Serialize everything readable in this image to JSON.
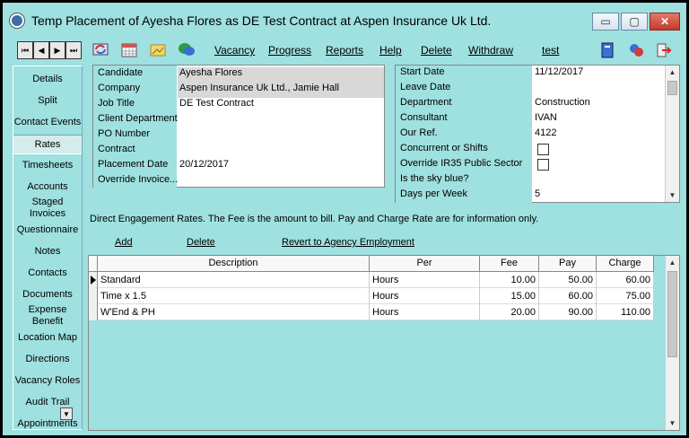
{
  "window": {
    "title": "Temp Placement of Ayesha Flores as DE Test Contract at Aspen Insurance Uk Ltd.",
    "minimize": "▭",
    "maximize": "▢",
    "close": "✕"
  },
  "toolbar": {
    "menus": [
      "Vacancy",
      "Progress",
      "Reports",
      "Help",
      "Delete",
      "Withdraw",
      "test"
    ]
  },
  "sidebar": {
    "items": [
      "Details",
      "Split",
      "Contact Events",
      "Rates",
      "Timesheets",
      "Accounts",
      "Staged Invoices",
      "Questionnaire",
      "Notes",
      "Contacts",
      "Documents",
      "Expense Benefit",
      "Location Map",
      "Directions",
      "Vacancy Roles",
      "Audit Trail",
      "Appointments"
    ],
    "active": "Rates"
  },
  "details_left": [
    {
      "label": "Candidate",
      "value": "Ayesha Flores"
    },
    {
      "label": "Company",
      "value": "Aspen Insurance Uk Ltd., Jamie Hall"
    },
    {
      "label": "Job Title",
      "value": "DE Test Contract"
    },
    {
      "label": "Client Department",
      "value": ""
    },
    {
      "label": "PO Number",
      "value": ""
    },
    {
      "label": "Contract",
      "value": ""
    },
    {
      "label": "Placement Date",
      "value": "20/12/2017"
    },
    {
      "label": "Override Invoice...",
      "value": ""
    }
  ],
  "details_right": [
    {
      "label": "Start Date",
      "value": "11/12/2017"
    },
    {
      "label": "Leave Date",
      "value": ""
    },
    {
      "label": "Department",
      "value": "Construction"
    },
    {
      "label": "Consultant",
      "value": "IVAN"
    },
    {
      "label": "Our Ref.",
      "value": "4122"
    },
    {
      "label": "Concurrent or Shifts",
      "value": ""
    },
    {
      "label": "Override IR35 Public Sector",
      "value": ""
    },
    {
      "label": "Is the sky blue?",
      "value": ""
    },
    {
      "label": "Days per Week",
      "value": "5"
    }
  ],
  "rates": {
    "note": "Direct Engagement Rates.  The Fee is the amount to bill.  Pay and Charge Rate are for information only.",
    "add": "Add",
    "delete": "Delete",
    "revert": "Revert to Agency Employment",
    "columns": [
      "Description",
      "Per",
      "Fee",
      "Pay",
      "Charge"
    ],
    "rows": [
      [
        "Standard",
        "Hours",
        "10.00",
        "50.00",
        "60.00"
      ],
      [
        "Time x 1.5",
        "Hours",
        "15.00",
        "60.00",
        "75.00"
      ],
      [
        "W'End & PH",
        "Hours",
        "20.00",
        "90.00",
        "110.00"
      ]
    ]
  }
}
